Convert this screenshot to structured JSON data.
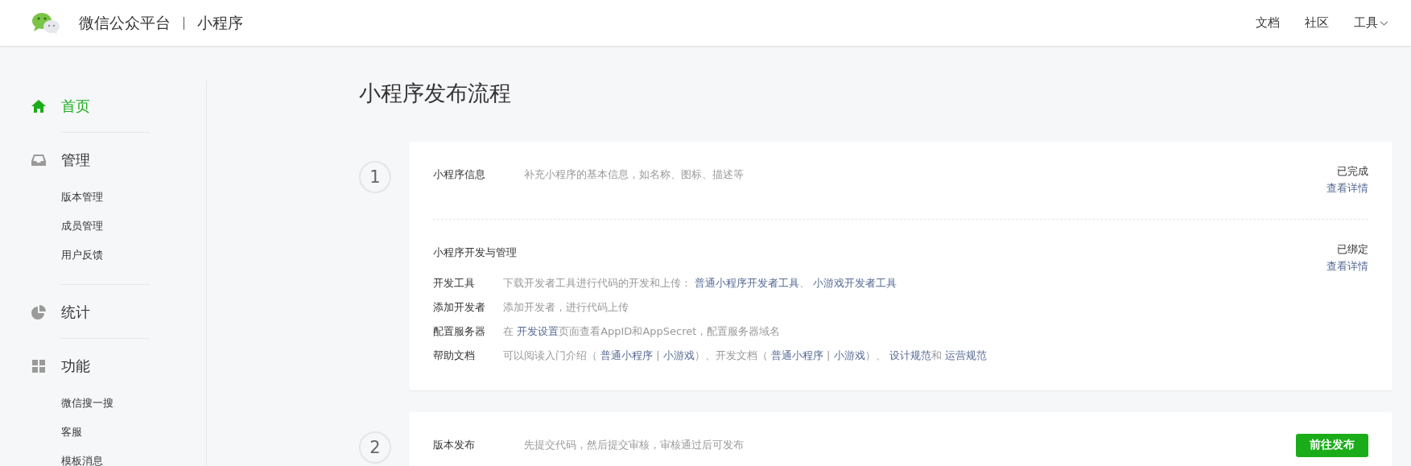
{
  "header": {
    "brand": "微信公众平台",
    "product": "小程序",
    "nav": [
      {
        "label": "文档",
        "dropdown": false
      },
      {
        "label": "社区",
        "dropdown": false
      },
      {
        "label": "工具",
        "dropdown": true
      }
    ]
  },
  "sidebar": {
    "sections": [
      {
        "label": "首页",
        "kind": "home",
        "selected": true
      },
      {
        "label": "管理",
        "kind": "inbox",
        "selected": false,
        "children": [
          {
            "label": "版本管理"
          },
          {
            "label": "成员管理"
          },
          {
            "label": "用户反馈"
          }
        ]
      },
      {
        "label": "统计",
        "kind": "pie",
        "selected": false
      },
      {
        "label": "功能",
        "kind": "grid",
        "selected": false,
        "children": [
          {
            "label": "微信搜一搜"
          },
          {
            "label": "客服"
          },
          {
            "label": "模板消息"
          }
        ]
      }
    ]
  },
  "main": {
    "title": "小程序发布流程",
    "steps": [
      {
        "number": "1",
        "sections": [
          {
            "title": "小程序信息",
            "description": "补充小程序的基本信息，如名称、图标、描述等",
            "status": "已完成",
            "link": "查看详情"
          },
          {
            "title": "小程序开发与管理",
            "status": "已绑定",
            "link": "查看详情",
            "rows": [
              {
                "label": "开发工具",
                "segments": [
                  {
                    "text": "下载开发者工具进行代码的开发和上传： ",
                    "link": false
                  },
                  {
                    "text": "普通小程序开发者工具",
                    "link": true
                  },
                  {
                    "text": "、 ",
                    "link": false
                  },
                  {
                    "text": "小游戏开发者工具",
                    "link": true
                  }
                ]
              },
              {
                "label": "添加开发者",
                "segments": [
                  {
                    "text": "添加开发者，进行代码上传",
                    "link": false
                  }
                ]
              },
              {
                "label": "配置服务器",
                "segments": [
                  {
                    "text": "在 ",
                    "link": false
                  },
                  {
                    "text": "开发设置",
                    "link": true
                  },
                  {
                    "text": "页面查看AppID和AppSecret，配置服务器域名",
                    "link": false
                  }
                ]
              },
              {
                "label": "帮助文档",
                "segments": [
                  {
                    "text": "可以阅读入门介绍（ ",
                    "link": false
                  },
                  {
                    "text": "普通小程序",
                    "link": true
                  },
                  {
                    "text": " | ",
                    "link": false
                  },
                  {
                    "text": "小游戏",
                    "link": true
                  },
                  {
                    "text": "）、开发文档（ ",
                    "link": false
                  },
                  {
                    "text": "普通小程序",
                    "link": true
                  },
                  {
                    "text": " | ",
                    "link": false
                  },
                  {
                    "text": "小游戏",
                    "link": true
                  },
                  {
                    "text": "）、 ",
                    "link": false
                  },
                  {
                    "text": "设计规范",
                    "link": true
                  },
                  {
                    "text": "和 ",
                    "link": false
                  },
                  {
                    "text": "运营规范",
                    "link": true
                  }
                ]
              }
            ]
          }
        ]
      },
      {
        "number": "2",
        "sections": [
          {
            "title": "版本发布",
            "description": "先提交代码，然后提交审核，审核通过后可发布",
            "button": "前往发布"
          }
        ]
      }
    ]
  }
}
